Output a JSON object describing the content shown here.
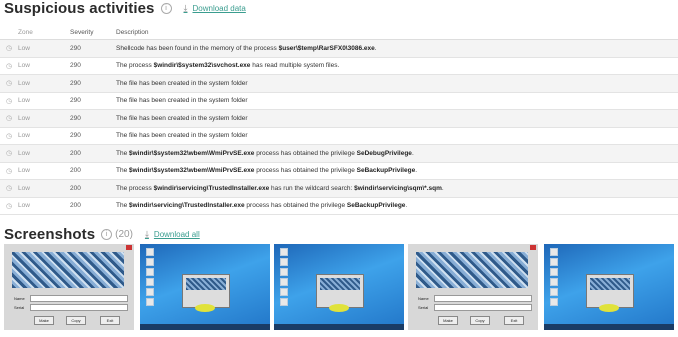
{
  "suspicious": {
    "title": "Suspicious activities",
    "download_label": "Download data",
    "columns": {
      "zone": "Zone",
      "severity": "Severity",
      "description": "Description"
    },
    "rows": [
      {
        "zone": "Low",
        "severity": "290",
        "pre": "Shellcode has been found in the memory of the process ",
        "bold1": "$user\\$temp\\RarSFX0\\3086.exe",
        "mid": ".",
        "bold2": "",
        "post": ""
      },
      {
        "zone": "Low",
        "severity": "290",
        "pre": "The process ",
        "bold1": "$windir\\$system32\\svchost.exe",
        "mid": " has read multiple system files.",
        "bold2": "",
        "post": ""
      },
      {
        "zone": "Low",
        "severity": "290",
        "pre": "The file has been created in the system folder",
        "bold1": "",
        "mid": "",
        "bold2": "",
        "post": ""
      },
      {
        "zone": "Low",
        "severity": "290",
        "pre": "The file has been created in the system folder",
        "bold1": "",
        "mid": "",
        "bold2": "",
        "post": ""
      },
      {
        "zone": "Low",
        "severity": "290",
        "pre": "The file has been created in the system folder",
        "bold1": "",
        "mid": "",
        "bold2": "",
        "post": ""
      },
      {
        "zone": "Low",
        "severity": "290",
        "pre": "The file has been created in the system folder",
        "bold1": "",
        "mid": "",
        "bold2": "",
        "post": ""
      },
      {
        "zone": "Low",
        "severity": "200",
        "pre": "The ",
        "bold1": "$windir\\$system32\\wbem\\WmiPrvSE.exe",
        "mid": " process has obtained the privilege ",
        "bold2": "SeDebugPrivilege",
        "post": "."
      },
      {
        "zone": "Low",
        "severity": "200",
        "pre": "The ",
        "bold1": "$windir\\$system32\\wbem\\WmiPrvSE.exe",
        "mid": " process has obtained the privilege ",
        "bold2": "SeBackupPrivilege",
        "post": "."
      },
      {
        "zone": "Low",
        "severity": "200",
        "pre": "The process ",
        "bold1": "$windir\\servicing\\TrustedInstaller.exe",
        "mid": " has run the wildcard search: ",
        "bold2": "$windir\\servicing\\sqm\\*.sqm",
        "post": "."
      },
      {
        "zone": "Low",
        "severity": "200",
        "pre": "The ",
        "bold1": "$windir\\servicing\\TrustedInstaller.exe",
        "mid": " process has obtained the privilege ",
        "bold2": "SeBackupPrivilege",
        "post": "."
      }
    ]
  },
  "screenshots": {
    "title": "Screenshots",
    "count": "(20)",
    "download_label": "Download all",
    "app_labels": {
      "name": "Name",
      "serial": "Serial",
      "make": "Make",
      "copy": "Copy",
      "exit": "Exit"
    },
    "thumbs": [
      "app",
      "desktop",
      "desktop",
      "app",
      "desktop"
    ]
  },
  "icons": {
    "info": "info-icon",
    "download": "download-icon",
    "expand": "clock-icon"
  },
  "colors": {
    "accent": "#3a9d8f",
    "stripe": "#f4f4f4"
  }
}
